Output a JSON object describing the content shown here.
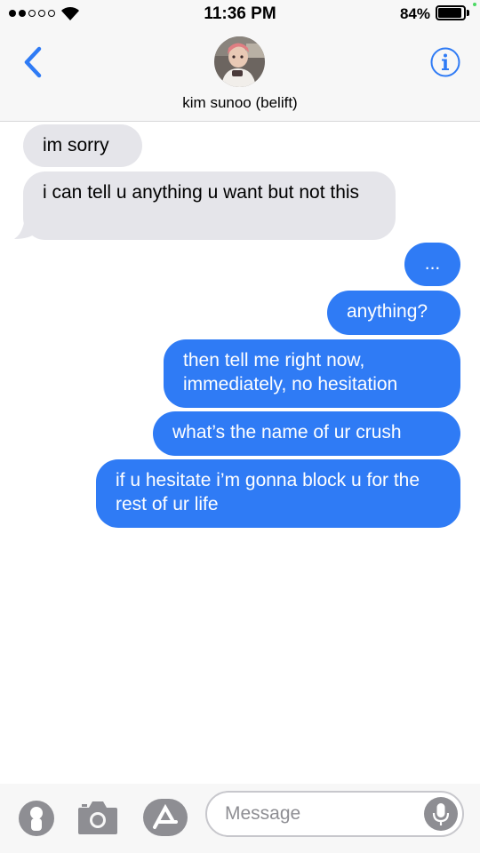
{
  "status_bar": {
    "time": "11:36 PM",
    "battery_percent": "84%",
    "signal_bars_filled": 2,
    "signal_bars_total": 5
  },
  "header": {
    "contact_name": "kim sunoo (belift)",
    "back_icon": "chevron-left-icon",
    "info_icon": "info-circle-icon",
    "accent_color": "#2f7bf5"
  },
  "messages": [
    {
      "direction": "received",
      "text": "im sorry"
    },
    {
      "direction": "received",
      "text": "i can tell u anything u want but not this"
    },
    {
      "direction": "sent",
      "text": "..."
    },
    {
      "direction": "sent",
      "text": "anything?"
    },
    {
      "direction": "sent",
      "text": "then tell me right now, immediately, no hesitation"
    },
    {
      "direction": "sent",
      "text": "what’s the name of ur crush"
    },
    {
      "direction": "sent",
      "text": "if u hesitate i’m gonna block u for the rest of ur life"
    }
  ],
  "colors": {
    "sent_bubble": "#2f7bf5",
    "received_bubble": "#e5e5ea",
    "bar_background": "#f7f7f7"
  },
  "input_bar": {
    "placeholder": "Message",
    "icons": [
      "contact-icon",
      "camera-icon",
      "app-store-icon",
      "microphone-icon"
    ]
  }
}
